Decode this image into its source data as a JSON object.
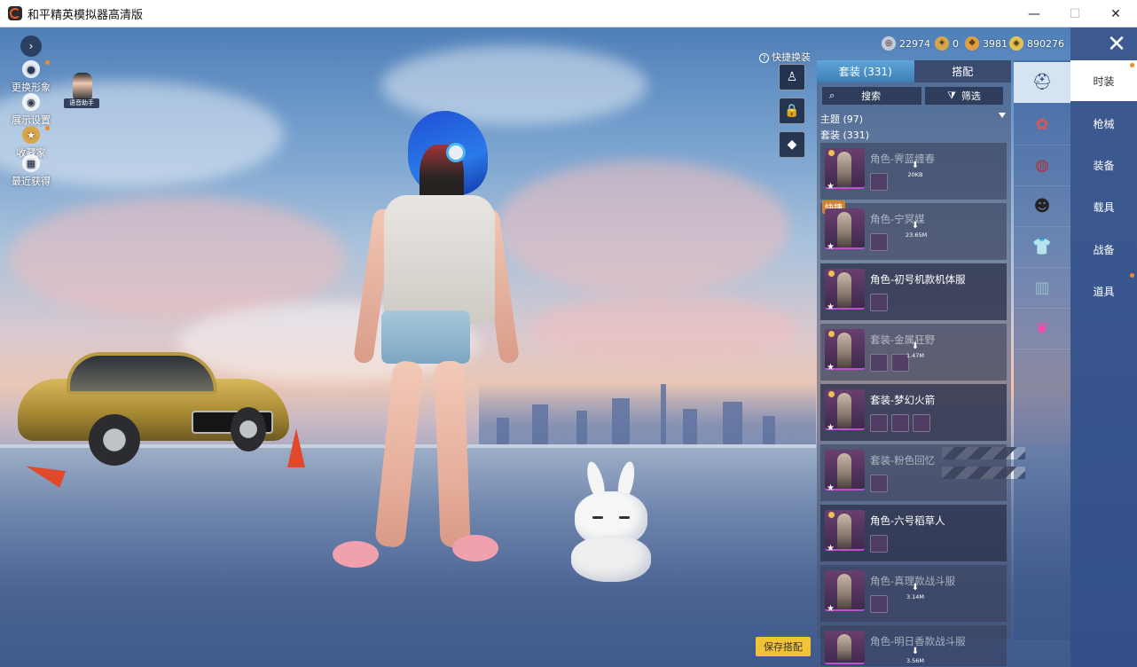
{
  "window": {
    "title": "和平精英模拟器高清版",
    "minimize": "—",
    "maximize": "☐",
    "close": "✕"
  },
  "left_menu": {
    "items": [
      {
        "label": "更换形象",
        "icon": "person-icon"
      },
      {
        "label": "展示设置",
        "icon": "eye-icon"
      },
      {
        "label": "收藏家",
        "icon": "medal-icon"
      },
      {
        "label": "最近获得",
        "icon": "gift-icon"
      }
    ],
    "assistant_label": "语音助手"
  },
  "currencies": [
    {
      "value": "22974",
      "color": "#c9ccd6"
    },
    {
      "value": "0",
      "color": "#d8a64a"
    },
    {
      "value": "3981",
      "color": "#e0a040"
    },
    {
      "value": "890276",
      "color": "#e6c250"
    }
  ],
  "quick_swap": {
    "label": "快捷换装",
    "help": "?"
  },
  "panel": {
    "tabs": [
      "套装 (331)",
      "搭配"
    ],
    "search": "搜索",
    "filter": "筛选",
    "theme_heading": "主题 (97)",
    "set_heading": "套装 (331)"
  },
  "outfits": [
    {
      "name": "角色-霁蓝缠春",
      "size": "20KB",
      "dim": true
    },
    {
      "name": "角色-宁冥媒",
      "size": "23.65M",
      "dim": true,
      "badge": "快捷"
    },
    {
      "name": "角色-初号机款机体服",
      "size": "",
      "dim": false
    },
    {
      "name": "套装-金属狂野",
      "size": "1.47M",
      "dim": true
    },
    {
      "name": "套装-梦幻火箭",
      "size": "",
      "dim": false
    },
    {
      "name": "套装-粉色回忆",
      "size": "",
      "dim": true
    },
    {
      "name": "角色-六号稻草人",
      "size": "",
      "dim": false
    },
    {
      "name": "角色-真理款战斗服",
      "size": "3.14M",
      "dim": true
    },
    {
      "name": "角色-明日香款战斗服",
      "size": "3.56M",
      "dim": true
    }
  ],
  "right_nav": {
    "items": [
      "时装",
      "枪械",
      "装备",
      "载具",
      "战备",
      "道具"
    ]
  },
  "save_button": "保存搭配",
  "accent": "#3c7fb8"
}
